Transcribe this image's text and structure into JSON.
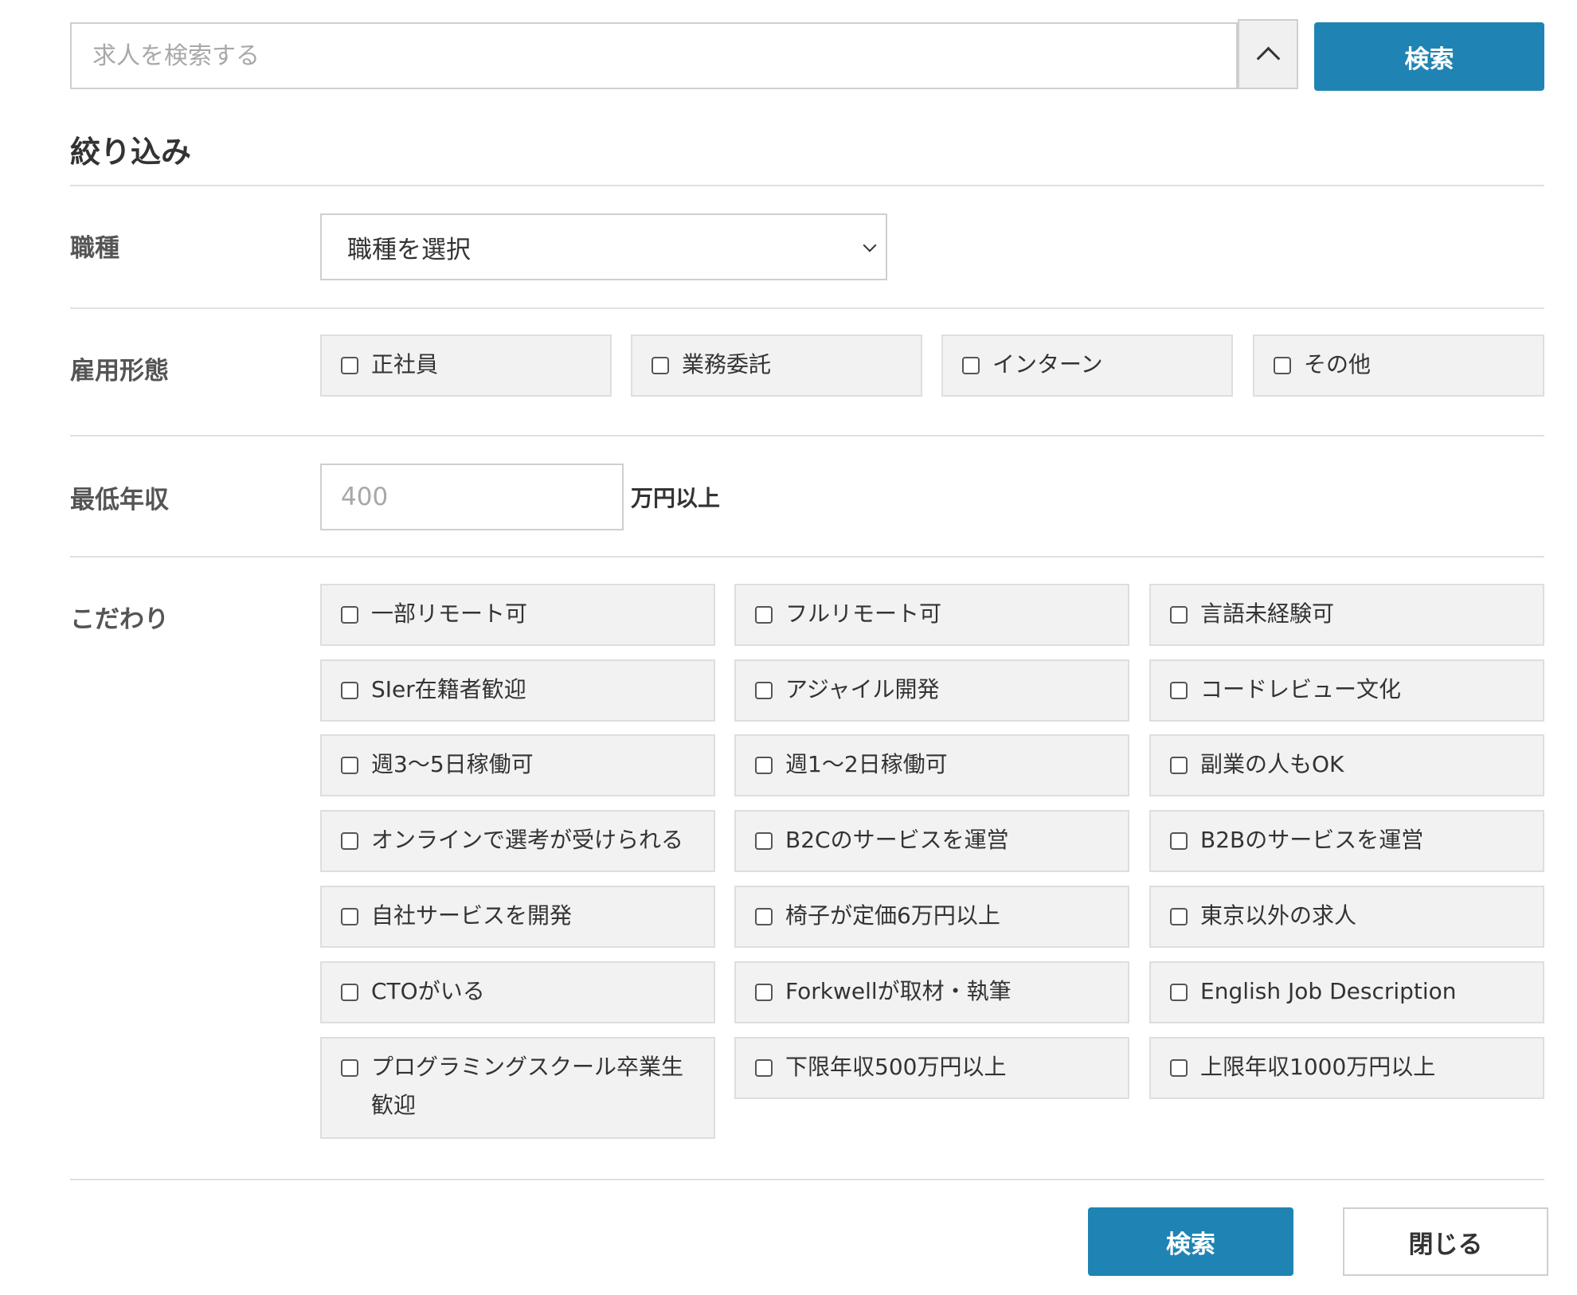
{
  "search": {
    "placeholder": "求人を検索する",
    "value": "",
    "submit_label": "検索"
  },
  "filter": {
    "title": "絞り込み",
    "job_type": {
      "label": "職種",
      "selected": "職種を選択"
    },
    "employment": {
      "label": "雇用形態",
      "options": [
        "正社員",
        "業務委託",
        "インターン",
        "その他"
      ]
    },
    "min_salary": {
      "label": "最低年収",
      "placeholder": "400",
      "value": "",
      "unit": "万円以上"
    },
    "preferences": {
      "label": "こだわり",
      "options": [
        "一部リモート可",
        "フルリモート可",
        "言語未経験可",
        "SIer在籍者歓迎",
        "アジャイル開発",
        "コードレビュー文化",
        "週3〜5日稼働可",
        "週1〜2日稼働可",
        "副業の人もOK",
        "オンラインで選考が受けられる",
        "B2Cのサービスを運営",
        "B2Bのサービスを運営",
        "自社サービスを開発",
        "椅子が定価6万円以上",
        "東京以外の求人",
        "CTOがいる",
        "Forkwellが取材・執筆",
        "English Job Description",
        "プログラミングスクール卒業生歓迎",
        "下限年収500万円以上",
        "上限年収1000万円以上"
      ]
    }
  },
  "footer": {
    "search_label": "検索",
    "close_label": "閉じる"
  },
  "colors": {
    "primary": "#1f84b3",
    "tile_bg": "#f2f2f2",
    "divider": "#e0e0e0"
  }
}
